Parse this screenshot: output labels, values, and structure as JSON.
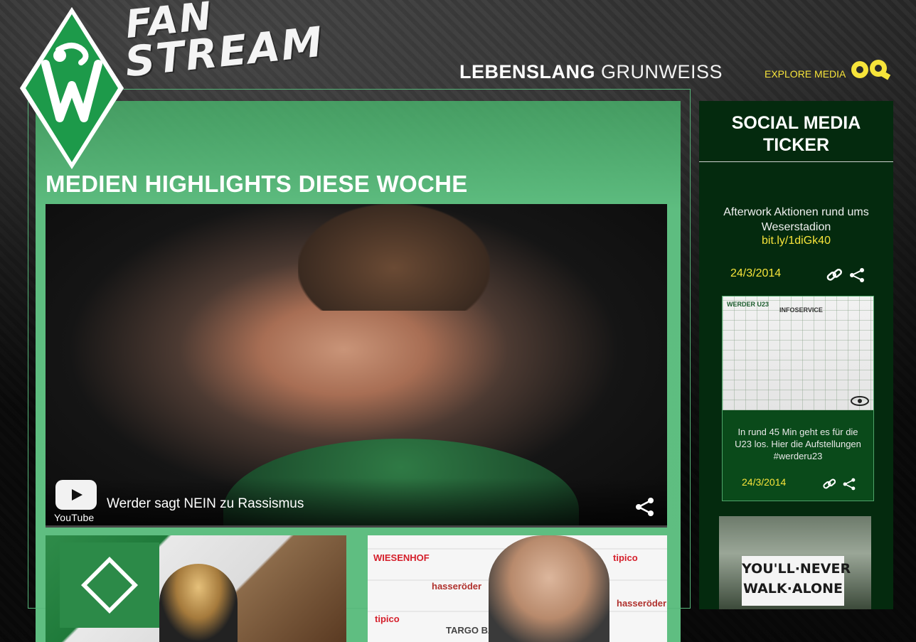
{
  "header": {
    "brand_line1": "FAN",
    "brand_line2": "STREAM",
    "tagline_bold": "LEBENSLANG",
    "tagline_light": "GRUNWEISS",
    "explore_label": "EXPLORE MEDIA"
  },
  "main": {
    "title": "MEDIEN HIGHLIGHTS DIESE WOCHE",
    "video": {
      "title": "Werder sagt NEIN zu Rassismus",
      "provider": "YouTube"
    }
  },
  "thumb2_sponsors": [
    "WIESENHOF",
    "tipico",
    "hasseröder",
    "TARGO BANK"
  ],
  "sidebar": {
    "title": "SOCIAL MEDIA TICKER",
    "tweets": [
      {
        "text": "Afterwork Aktionen rund ums Weserstadion",
        "link": "bit.ly/1diGk40",
        "date": "24/3/2014"
      },
      {
        "image_header": "WERDER U23",
        "image_header2": "INFOSERVICE",
        "text": "In rund 45 Min geht es für die U23 los. Hier die Aufstellungen #werderu23",
        "date": "24/3/2014"
      },
      {
        "image_text": "YOU'LL·NEVER WALK·ALONE"
      }
    ]
  },
  "colors": {
    "accent_green": "#5fbe81",
    "dark_green": "#042a0e",
    "yellow": "#f7e43a"
  }
}
